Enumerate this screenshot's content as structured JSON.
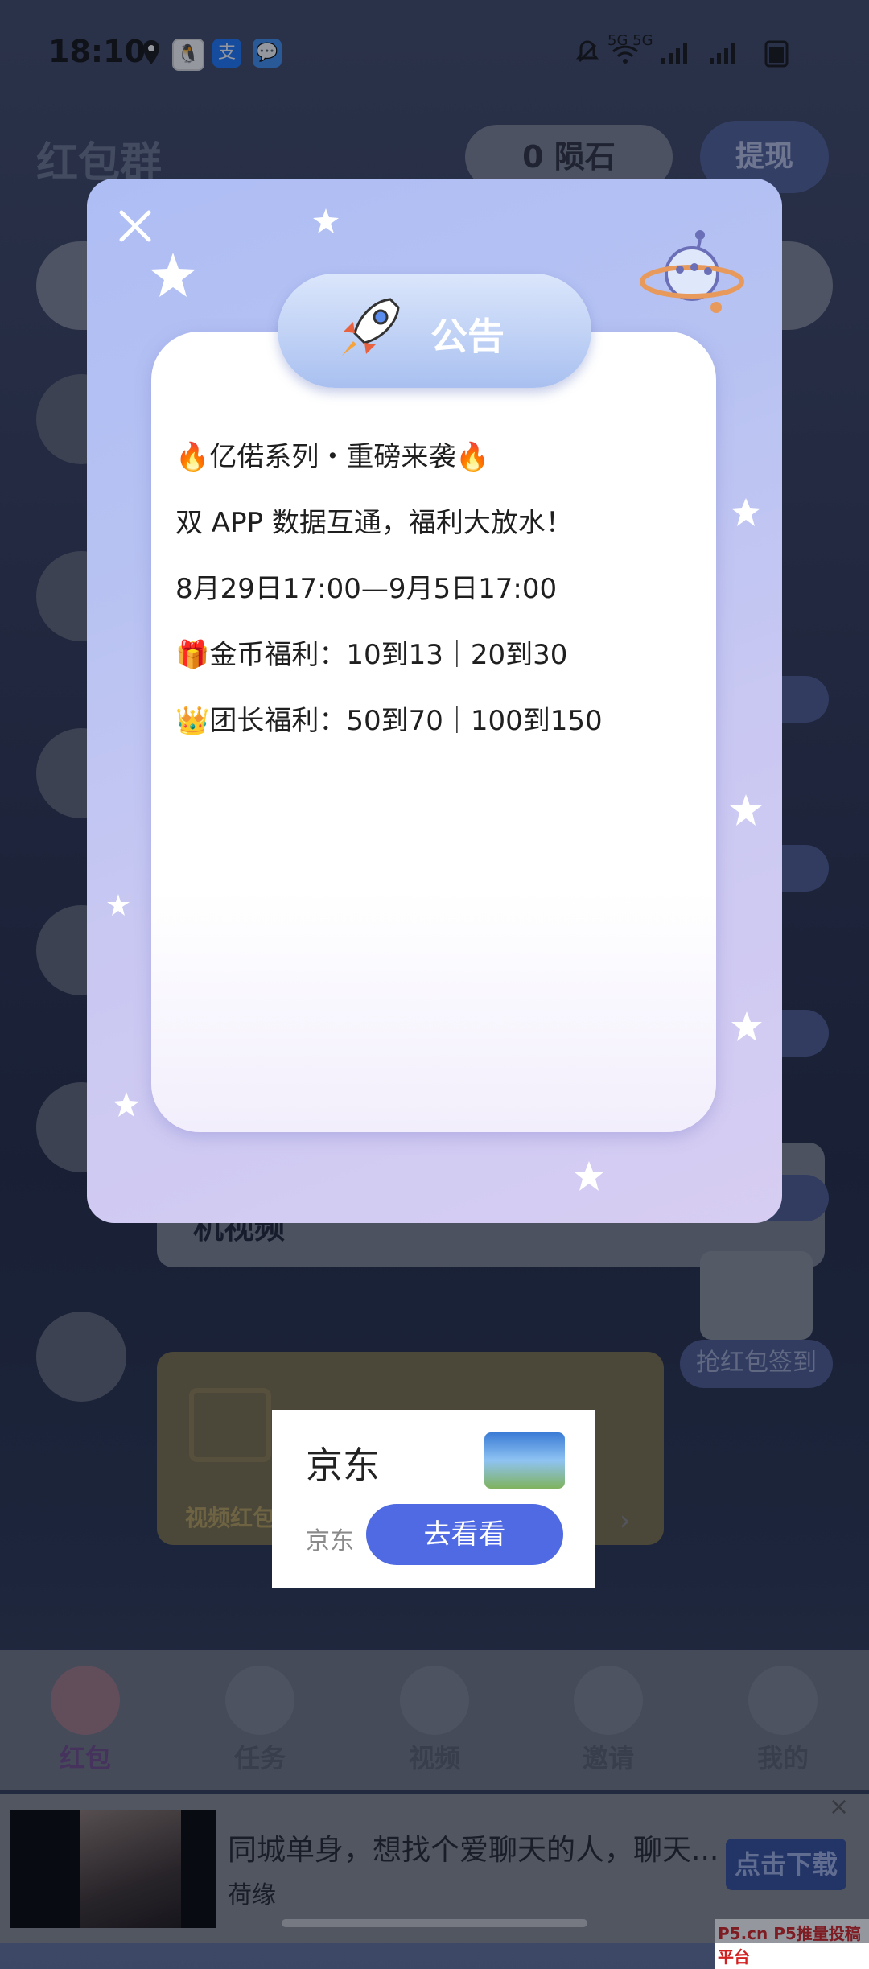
{
  "status_bar": {
    "time": "18:10",
    "network": "5G 5G"
  },
  "background_app": {
    "title": "红包群",
    "meteor_badge": "0 陨石",
    "withdraw_button": "提现",
    "video_text": "机视频",
    "gold_card_link": "视频红包",
    "side_buttons": [
      "抢红包签到"
    ],
    "grab_label": "抢红包签到"
  },
  "modal": {
    "title": "公告",
    "lines": [
      "🔥亿偌系列・重磅来袭🔥",
      "双 APP 数据互通，福利大放水！",
      "8月29日17:00—9月5日17:00",
      "🎁金币福利：10到13｜20到30",
      "👑团长福利：50到70｜100到150"
    ]
  },
  "jd_popup": {
    "title": "京东",
    "brand": "京东",
    "button": "去看看"
  },
  "bottom_nav": {
    "items": [
      "红包",
      "任务",
      "视频",
      "邀请",
      "我的"
    ]
  },
  "ad": {
    "title": "同城单身，想找个爱聊天的人，聊天...",
    "sub": "荷缘",
    "button": "点击下载"
  },
  "watermark": "P5.cn P5推量投稿平台"
}
